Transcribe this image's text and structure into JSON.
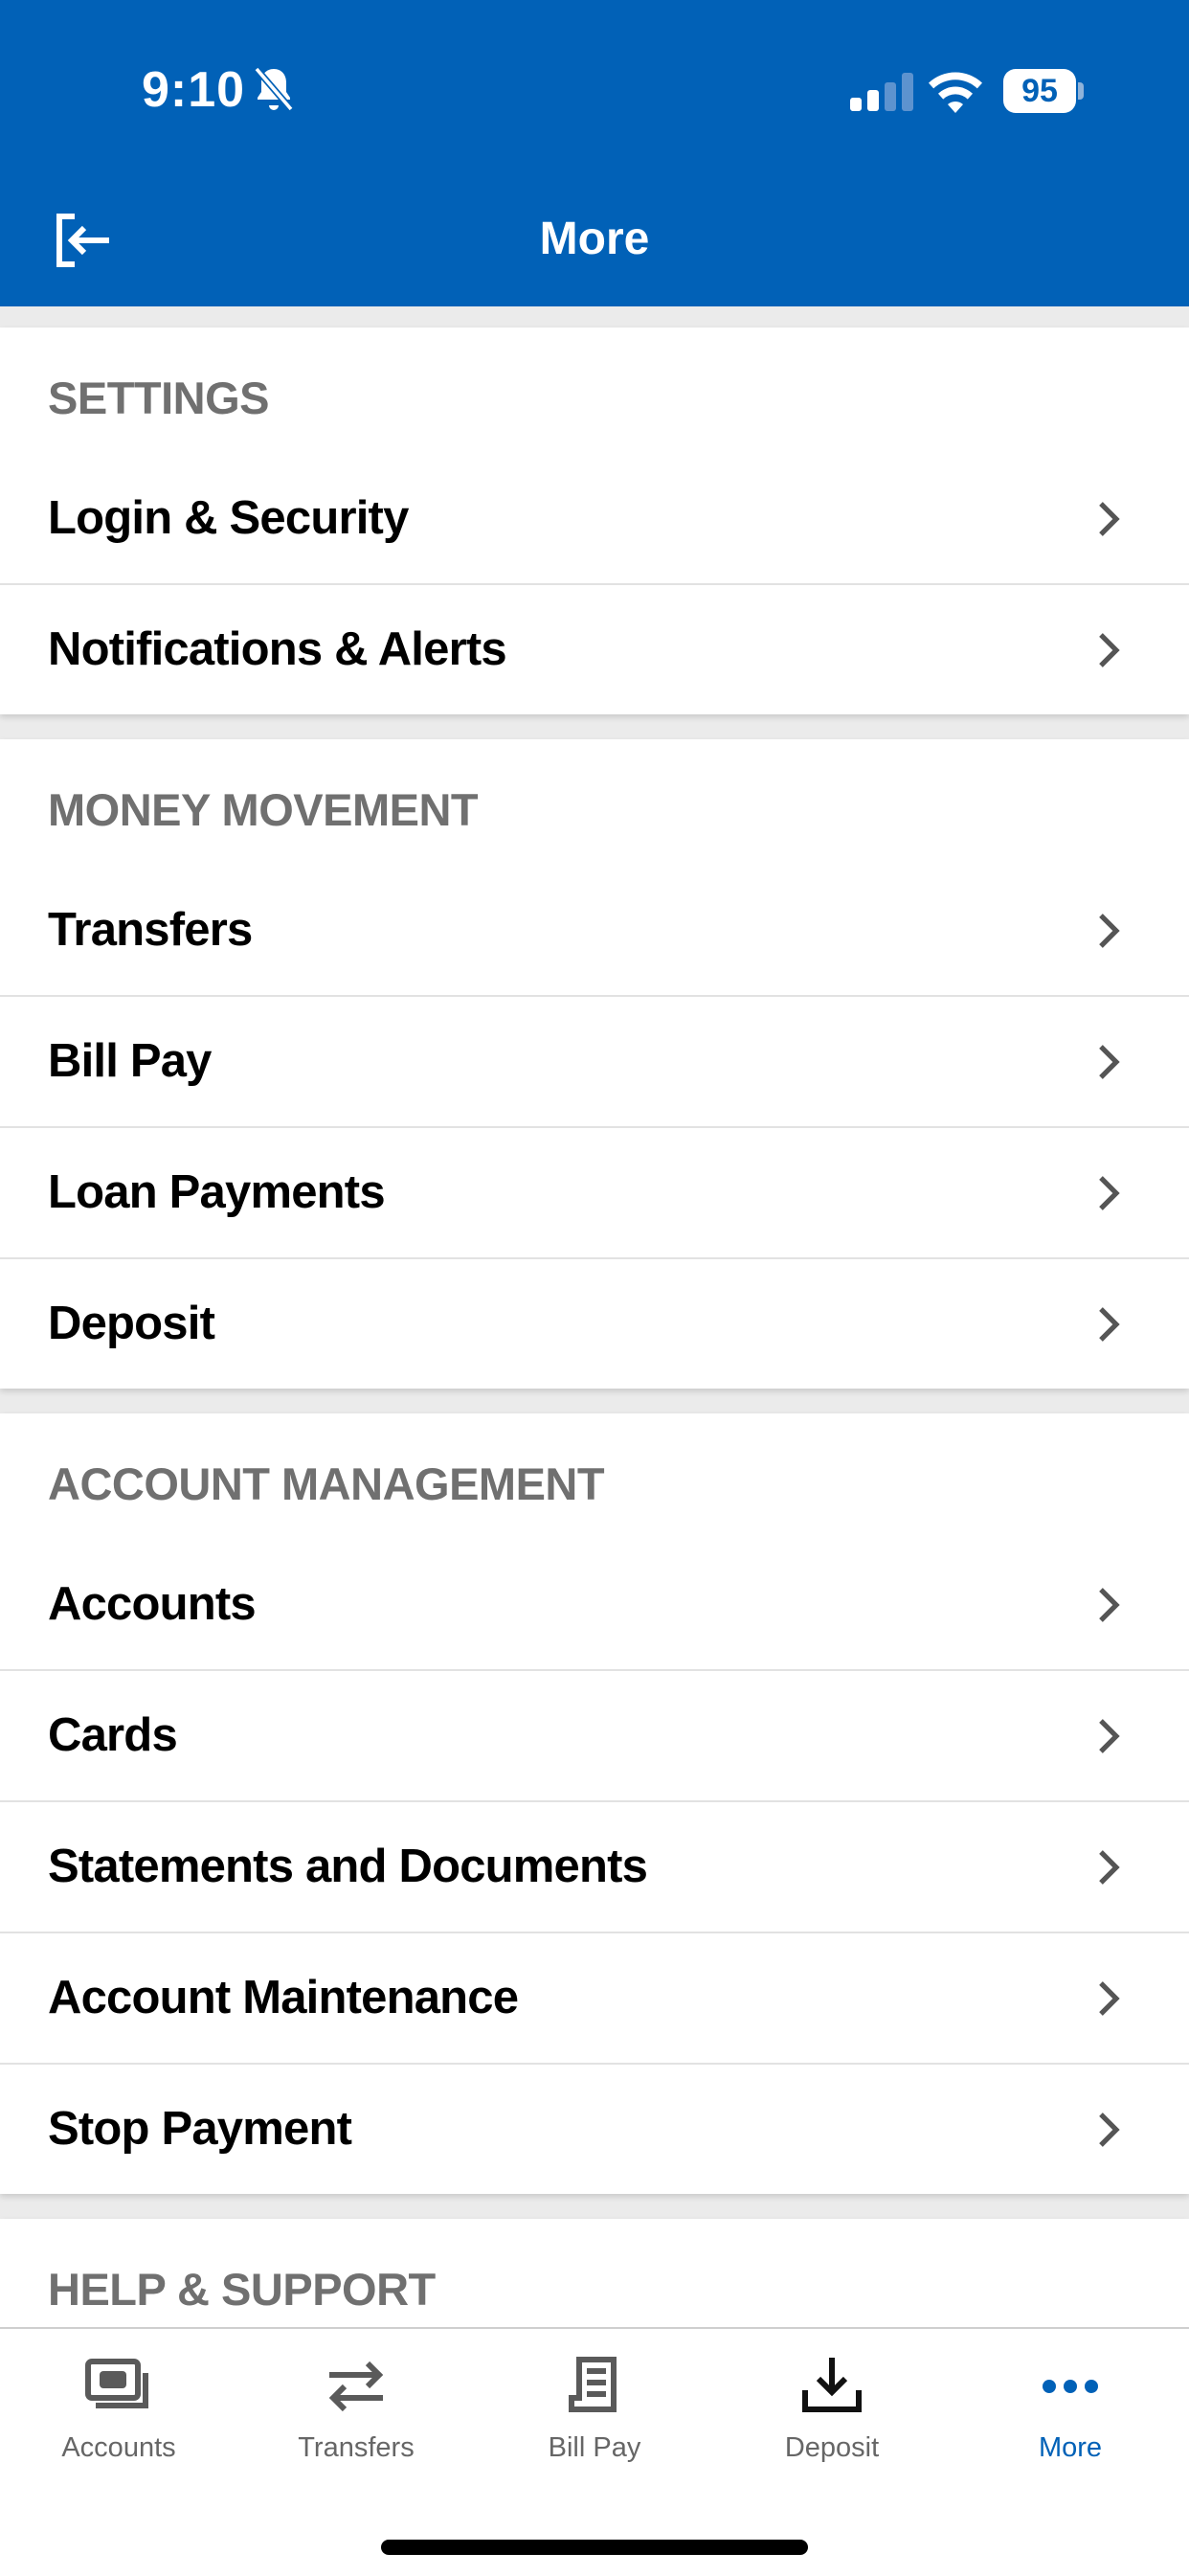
{
  "status_bar": {
    "time": "9:10",
    "battery": "95"
  },
  "header": {
    "title": "More"
  },
  "sections": [
    {
      "title": "SETTINGS",
      "items": [
        "Login & Security",
        "Notifications & Alerts"
      ]
    },
    {
      "title": "MONEY MOVEMENT",
      "items": [
        "Transfers",
        "Bill Pay",
        "Loan Payments",
        "Deposit"
      ]
    },
    {
      "title": "ACCOUNT MANAGEMENT",
      "items": [
        "Accounts",
        "Cards",
        "Statements and Documents",
        "Account Maintenance",
        "Stop Payment"
      ]
    },
    {
      "title": "HELP & SUPPORT",
      "items": []
    }
  ],
  "tabbar": {
    "tabs": [
      {
        "label": "Accounts",
        "icon": "accounts-icon"
      },
      {
        "label": "Transfers",
        "icon": "transfers-icon"
      },
      {
        "label": "Bill Pay",
        "icon": "bill-pay-icon"
      },
      {
        "label": "Deposit",
        "icon": "deposit-icon"
      },
      {
        "label": "More",
        "icon": "more-icon",
        "active": true
      }
    ]
  },
  "colors": {
    "brand": "#0161b7",
    "active_tab": "#0161b7",
    "section_header": "#707070"
  }
}
